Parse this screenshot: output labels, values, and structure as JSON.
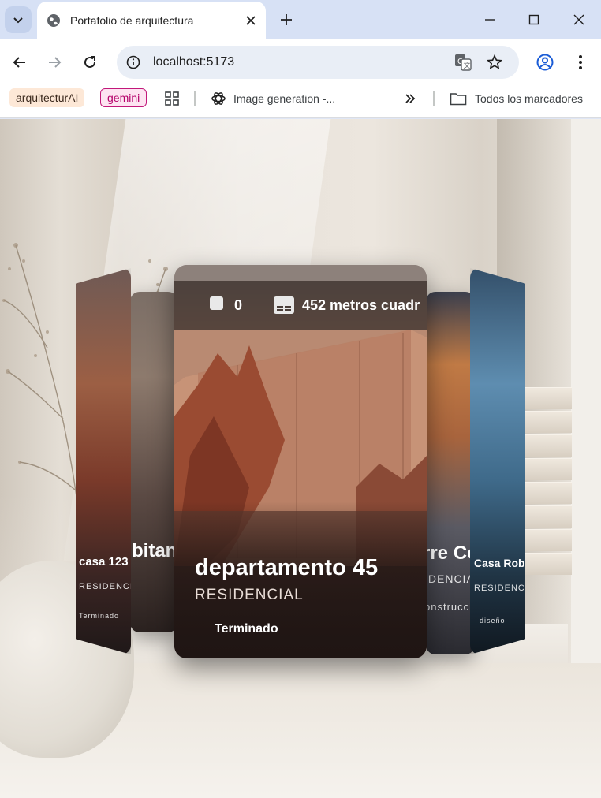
{
  "browser": {
    "tab_title": "Portafolio de arquitectura",
    "url": "localhost:5173",
    "bookmarks": {
      "chip1": "arquitecturAI",
      "chip2": "gemini",
      "item_image": "Image generation -...",
      "all_bookmarks": "Todos los marcadores"
    }
  },
  "carousel": {
    "active_card": {
      "count": "0",
      "area": "452 metros cuadr",
      "title": "departamento 45",
      "category": "RESIDENCIAL",
      "status": "Terminado"
    },
    "side_cards": {
      "left_front_title": "casa 123",
      "left_front_sub": "RESIDENCIAL",
      "left_front_status": "Terminado",
      "left_back_title": "bitan",
      "right_back_title": "rre Co",
      "right_back_sub": "IDENCIA",
      "right_back_status": "onstrucció",
      "right_front_title": "Casa Roble",
      "right_front_sub": "RESIDENCIAL",
      "right_front_status": "diseño"
    }
  }
}
